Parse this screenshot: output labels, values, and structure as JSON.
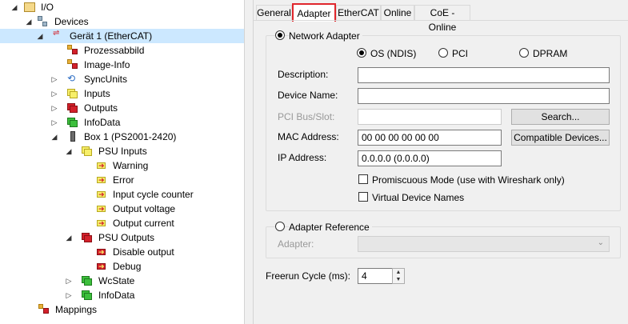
{
  "tree": {
    "items": [
      {
        "label": "I/O",
        "icon": "io-folder-icon"
      },
      {
        "label": "Devices",
        "icon": "devices-icon"
      },
      {
        "label": "Gerät 1 (EtherCAT)",
        "icon": "ethercat-device-icon"
      },
      {
        "label": "Prozessabbild",
        "icon": "process-image-icon"
      },
      {
        "label": "Image-Info",
        "icon": "image-info-icon"
      },
      {
        "label": "SyncUnits",
        "icon": "syncunits-icon"
      },
      {
        "label": "Inputs",
        "icon": "inputs-icon"
      },
      {
        "label": "Outputs",
        "icon": "outputs-icon"
      },
      {
        "label": "InfoData",
        "icon": "infodata-icon"
      },
      {
        "label": "Box 1 (PS2001-2420)",
        "icon": "box-icon"
      },
      {
        "label": "PSU Inputs",
        "icon": "inputs-icon"
      },
      {
        "label": "Warning",
        "icon": "input-variable-icon"
      },
      {
        "label": "Error",
        "icon": "input-variable-icon"
      },
      {
        "label": "Input cycle counter",
        "icon": "input-variable-icon"
      },
      {
        "label": "Output voltage",
        "icon": "input-variable-icon"
      },
      {
        "label": "Output current",
        "icon": "input-variable-icon"
      },
      {
        "label": "PSU Outputs",
        "icon": "outputs-icon"
      },
      {
        "label": "Disable output",
        "icon": "output-variable-icon"
      },
      {
        "label": "Debug",
        "icon": "output-variable-icon"
      },
      {
        "label": "WcState",
        "icon": "wcstate-icon"
      },
      {
        "label": "InfoData",
        "icon": "infodata-icon"
      },
      {
        "label": "Mappings",
        "icon": "mappings-icon"
      }
    ]
  },
  "tabs": [
    "General",
    "Adapter",
    "EtherCAT",
    "Online",
    "CoE - Online"
  ],
  "active_tab": "Adapter",
  "network_adapter": {
    "label": "Network Adapter",
    "options": [
      "OS (NDIS)",
      "PCI",
      "DPRAM"
    ],
    "selected": "OS (NDIS)",
    "description_label": "Description:",
    "description_value": "",
    "device_name_label": "Device Name:",
    "device_name_value": "",
    "pci_label": "PCI Bus/Slot:",
    "pci_value": "",
    "search_button": "Search...",
    "mac_label": "MAC Address:",
    "mac_value": "00 00 00 00 00 00",
    "compatible_button": "Compatible Devices...",
    "ip_label": "IP Address:",
    "ip_value": "0.0.0.0 (0.0.0.0)",
    "promiscuous_label": "Promiscuous Mode (use with Wireshark only)",
    "virtual_names_label": "Virtual Device Names"
  },
  "adapter_reference": {
    "label": "Adapter Reference",
    "adapter_label": "Adapter:",
    "adapter_value": ""
  },
  "freerun": {
    "label": "Freerun Cycle (ms):",
    "value": "4"
  },
  "colors": {
    "selected_row": "#cce8ff",
    "active_tab_border": "#e0262c",
    "panel_bg": "#f0f0f0"
  }
}
